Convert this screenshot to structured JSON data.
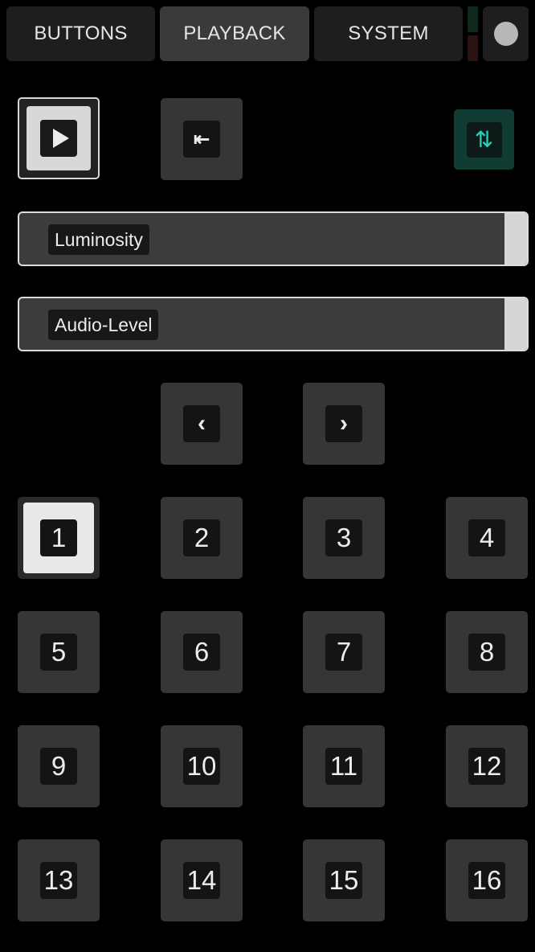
{
  "tabs": [
    {
      "label": "BUTTONS"
    },
    {
      "label": "PLAYBACK"
    },
    {
      "label": "SYSTEM"
    }
  ],
  "controls": {
    "rewind_glyph": "⇤",
    "swap_glyph": "⇅",
    "prev_glyph": "‹",
    "next_glyph": "›"
  },
  "sliders": [
    {
      "label": "Luminosity",
      "level": 1.0
    },
    {
      "label": "Audio-Level",
      "level": 1.0
    }
  ],
  "pads": [
    "1",
    "2",
    "3",
    "4",
    "5",
    "6",
    "7",
    "8",
    "9",
    "10",
    "11",
    "12",
    "13",
    "14",
    "15",
    "16"
  ],
  "selected_pad": "1",
  "colors": {
    "accent_teal": "#27d0b6",
    "swap_bg": "#103c34",
    "selected_face": "#e9e9e9"
  }
}
